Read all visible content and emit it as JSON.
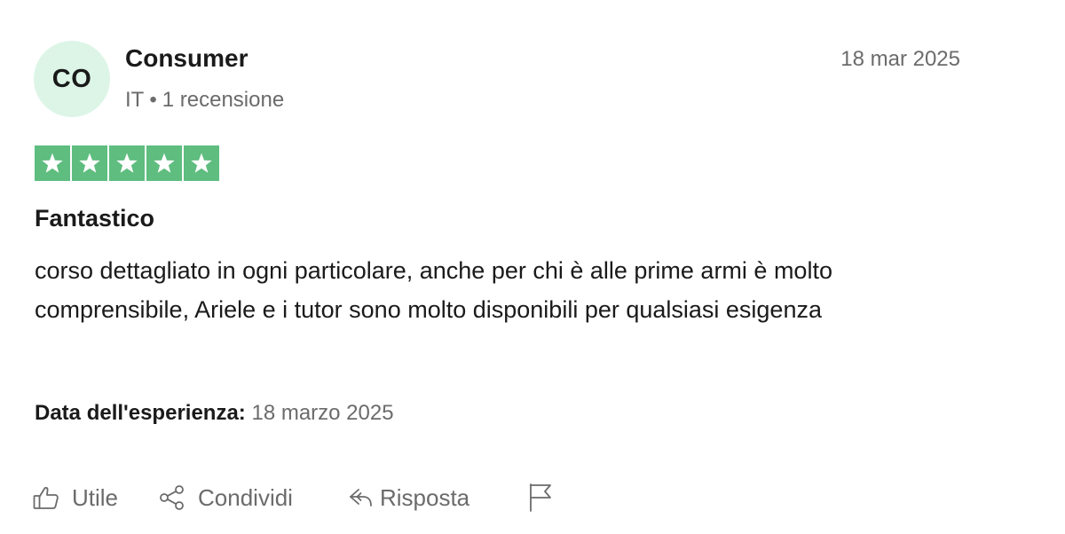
{
  "colors": {
    "avatar_bg": "#dcf5e7",
    "star_green": "#5ebd7f",
    "muted_text": "#6b6b6b",
    "primary_text": "#1a1a1a"
  },
  "author": {
    "initials": "CO",
    "name": "Consumer",
    "country": "IT",
    "separator": "•",
    "review_count": "1 recensione"
  },
  "review": {
    "date": "18 mar 2025",
    "rating": 5,
    "rating_max": 5,
    "title": "Fantastico",
    "body": "corso dettagliato in ogni particolare, anche per chi è alle prime armi è molto comprensibile, Ariele e i tutor sono molto disponibili per qualsiasi esigenza",
    "experience_label": "Data dell'esperienza:",
    "experience_date": "18 marzo 2025"
  },
  "actions": {
    "useful": {
      "label": "Utile",
      "icon": "thumbs-up-icon"
    },
    "share": {
      "label": "Condividi",
      "icon": "share-icon"
    },
    "reply": {
      "label": "Risposta",
      "icon": "reply-icon"
    },
    "report": {
      "icon": "flag-icon"
    }
  }
}
